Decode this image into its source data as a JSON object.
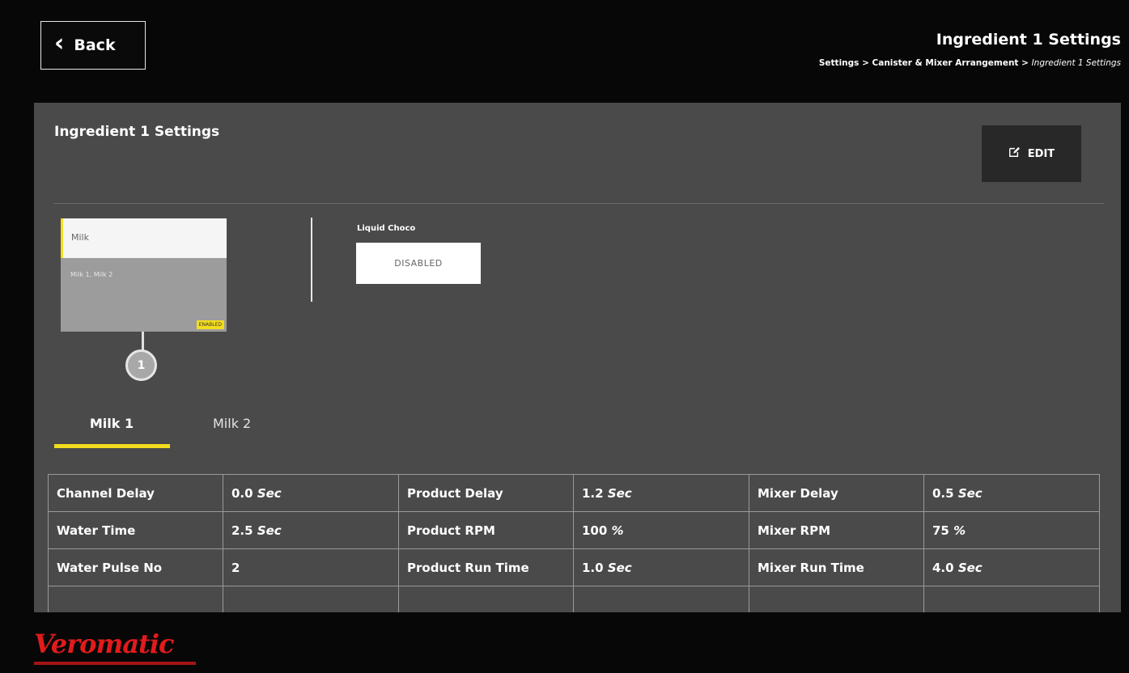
{
  "header": {
    "back_label": "Back",
    "title": "Ingredient 1 Settings",
    "breadcrumb": {
      "path": "Settings > Canister & Mixer Arrangement > ",
      "current": "Ingredient 1 Settings"
    }
  },
  "panel": {
    "title": "Ingredient 1 Settings",
    "edit_label": "EDIT",
    "card": {
      "name": "Milk",
      "subtitle": "Milk 1, Milk 2",
      "badge": "ENABLED",
      "number": "1"
    },
    "liquid_choco": {
      "label": "Liquid Choco",
      "state": "DISABLED"
    },
    "tabs": [
      "Milk 1",
      "Milk 2"
    ],
    "active_tab": "Milk 1",
    "table": {
      "rows": [
        {
          "c1": "Channel Delay",
          "v1n": "0.0",
          "v1u": "Sec",
          "c2": "Product Delay",
          "v2n": "1.2",
          "v2u": "Sec",
          "c3": "Mixer Delay",
          "v3n": "0.5",
          "v3u": "Sec"
        },
        {
          "c1": "Water Time",
          "v1n": "2.5",
          "v1u": "Sec",
          "c2": "Product RPM",
          "v2n": "100",
          "v2u": "%",
          "c3": "Mixer RPM",
          "v3n": "75",
          "v3u": "%"
        },
        {
          "c1": "Water Pulse No",
          "v1n": "2",
          "v1u": "",
          "c2": "Product Run Time",
          "v2n": "1.0",
          "v2u": "Sec",
          "c3": "Mixer Run Time",
          "v3n": "4.0",
          "v3u": "Sec"
        }
      ]
    }
  },
  "brand": "Veromatic",
  "colors": {
    "accent_yellow": "#f3dd1d",
    "panel_bg": "#4a4a4a",
    "brand_red": "#e11b1b"
  }
}
